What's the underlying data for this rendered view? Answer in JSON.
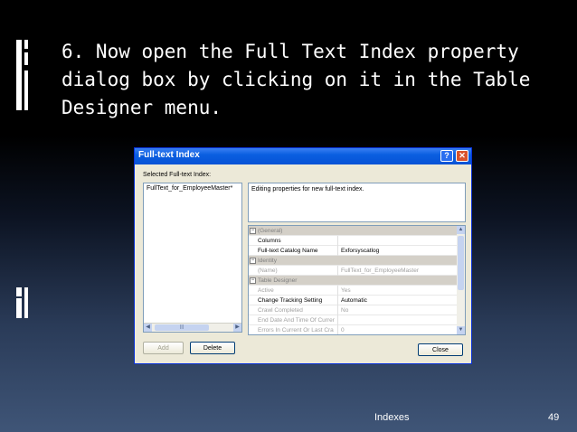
{
  "slide": {
    "title": "6. Now open the Full Text Index property dialog box by clicking on it in the Table Designer menu.",
    "footer": "Indexes",
    "page_number": "49"
  },
  "dialog": {
    "title": "Full-text Index",
    "help_label": "?",
    "close_label": "✕",
    "selected_label": "Selected Full-text Index:",
    "list_items": [
      "FullText_for_EmployeeMaster*"
    ],
    "description": "Editing properties for new full-text index.",
    "add_label": "Add",
    "delete_label": "Delete",
    "close_button_label": "Close",
    "properties": [
      {
        "kind": "category",
        "name": "(General)"
      },
      {
        "kind": "prop",
        "name": "Columns",
        "value": ""
      },
      {
        "kind": "prop",
        "name": "Full-text Catalog Name",
        "value": "Exforsyscatlog"
      },
      {
        "kind": "category",
        "name": "Identity"
      },
      {
        "kind": "gray",
        "name": "(Name)",
        "value": "FullText_for_EmployeeMaster"
      },
      {
        "kind": "category",
        "name": "Table Designer"
      },
      {
        "kind": "gray",
        "name": "Active",
        "value": "Yes"
      },
      {
        "kind": "prop",
        "name": "Change Tracking Setting",
        "value": "Automatic"
      },
      {
        "kind": "gray",
        "name": "Crawl Completed",
        "value": "No"
      },
      {
        "kind": "gray",
        "name": "End Date And Time Of Currer",
        "value": ""
      },
      {
        "kind": "gray",
        "name": "Errors In Current Or Last Cra",
        "value": "0"
      }
    ]
  }
}
